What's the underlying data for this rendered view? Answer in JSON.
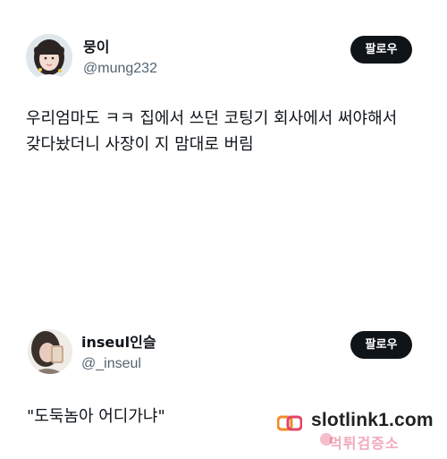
{
  "posts": [
    {
      "name": "뭉이",
      "handle": "@mung232",
      "follow_label": "팔로우",
      "text": "우리엄마도 ㅋㅋ 집에서 쓰던 코팅기 회사에서 써야해서\n갖다놨더니 사장이 지 맘대로 버림"
    },
    {
      "name": "inseul인슬",
      "handle": "@_inseul",
      "follow_label": "팔로우",
      "text": "\"도둑놈아 어디가냐\""
    }
  ],
  "watermark": {
    "url": "slotlink1.com",
    "sub": "먹튀검증소"
  },
  "colors": {
    "button_bg": "#0f1419",
    "handle": "#536471",
    "watermark_accent": "#e3446a"
  }
}
